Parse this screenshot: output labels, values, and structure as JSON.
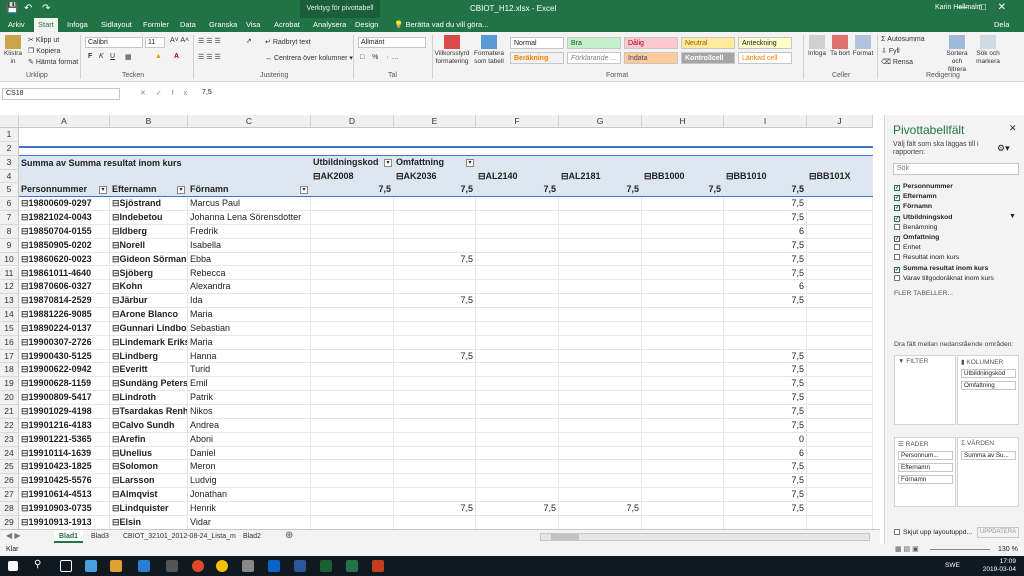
{
  "window": {
    "doc_title": "CBIOT_H12.xlsx - Excel",
    "context_tab": "Verktyg för pivottabell",
    "user": "Karin Hellmalm",
    "share": "Dela"
  },
  "tabs": [
    "Arkiv",
    "Start",
    "Infoga",
    "Sidlayout",
    "Formler",
    "Data",
    "Granska",
    "Visa",
    "Acrobat",
    "Analysera",
    "Design"
  ],
  "active_tab": "Start",
  "tell_me": "Berätta vad du vill göra...",
  "ribbon": {
    "clipboard": {
      "paste": "Klistra in",
      "cut": "Klipp ut",
      "copy": "Kopiera",
      "format_painter": "Hämta format",
      "label": "Urklipp"
    },
    "font": {
      "name": "Calibri",
      "size": "11",
      "label": "Tecken"
    },
    "alignment": {
      "wrap": "Radbryt text",
      "merge": "Centrera över kolumner",
      "label": "Justering"
    },
    "number": {
      "format": "Allmänt",
      "label": "Tal"
    },
    "styles": {
      "cond": "Villkorsstyrd formatering",
      "table": "Formatera som tabell",
      "cells": [
        "Normal",
        "Bra",
        "Dålig",
        "Neutral",
        "Anteckning",
        "Beräkning",
        "Förklarande ...",
        "Indata",
        "Kontrollcell",
        "Länkad cell"
      ],
      "label": "Format"
    },
    "cells_grp": {
      "insert": "Infoga",
      "delete": "Ta bort",
      "format": "Format",
      "label": "Celler"
    },
    "editing": {
      "autosum": "Autosumma",
      "fill": "Fyll",
      "clear": "Rensa",
      "sort": "Sortera och filtrera",
      "find": "Sök och markera",
      "label": "Redigering"
    }
  },
  "formula_bar": {
    "name_box": "CS18",
    "value": "7,5"
  },
  "columns": [
    "A",
    "B",
    "C",
    "D",
    "E",
    "F",
    "G",
    "H",
    "I",
    "J"
  ],
  "pivot": {
    "title": "Summa av Summa resultat inom kurs",
    "col_field1": "Utbildningskod",
    "col_field2": "Omfattning",
    "row_headers": [
      "Personnummer",
      "Efternamn",
      "Förnamn"
    ],
    "col_codes": [
      "AK2008",
      "AK2036",
      "AL2140",
      "AL2181",
      "BB1000",
      "BB1010",
      "BB101X"
    ],
    "col_totals": [
      "7,5",
      "7,5",
      "7,5",
      "7,5",
      "7,5",
      "7,5",
      ""
    ],
    "rows": [
      {
        "r": "6",
        "pn": "19800609-0297",
        "en": "Sjöstrand",
        "fn": "Marcus Paul",
        "v": [
          "",
          "",
          "",
          "",
          "",
          "7,5"
        ]
      },
      {
        "r": "7",
        "pn": "19821024-0043",
        "en": "Indebetou",
        "fn": "Johanna Lena Sörensdotter",
        "v": [
          "",
          "",
          "",
          "",
          "",
          "7,5"
        ]
      },
      {
        "r": "8",
        "pn": "19850704-0155",
        "en": "Idberg",
        "fn": "Fredrik",
        "v": [
          "",
          "",
          "",
          "",
          "",
          "6"
        ]
      },
      {
        "r": "9",
        "pn": "19850905-0202",
        "en": "Norell",
        "fn": "Isabella",
        "v": [
          "",
          "",
          "",
          "",
          "",
          "7,5"
        ]
      },
      {
        "r": "10",
        "pn": "19860620-0023",
        "en": "Gideon Sörman",
        "fn": "Ebba",
        "v": [
          "",
          "7,5",
          "",
          "",
          "",
          "7,5"
        ]
      },
      {
        "r": "11",
        "pn": "19861011-4640",
        "en": "Sjöberg",
        "fn": "Rebecca",
        "v": [
          "",
          "",
          "",
          "",
          "",
          "7,5"
        ]
      },
      {
        "r": "12",
        "pn": "19870606-0327",
        "en": "Kohn",
        "fn": "Alexandra",
        "v": [
          "",
          "",
          "",
          "",
          "",
          "6"
        ]
      },
      {
        "r": "13",
        "pn": "19870814-2529",
        "en": "Järbur",
        "fn": "Ida",
        "v": [
          "",
          "7,5",
          "",
          "",
          "",
          "7,5"
        ]
      },
      {
        "r": "14",
        "pn": "19881226-9085",
        "en": "Arone Blanco",
        "fn": "Maria",
        "v": [
          "",
          "",
          "",
          "",
          "",
          ""
        ]
      },
      {
        "r": "15",
        "pn": "19890224-0137",
        "en": "Gunnari Lindbor",
        "fn": "Sebastian",
        "v": [
          "",
          "",
          "",
          "",
          "",
          ""
        ]
      },
      {
        "r": "16",
        "pn": "19900307-2726",
        "en": "Lindemark Eriks",
        "fn": "Maria",
        "v": [
          "",
          "",
          "",
          "",
          "",
          ""
        ]
      },
      {
        "r": "17",
        "pn": "19900430-5125",
        "en": "Lindberg",
        "fn": "Hanna",
        "v": [
          "",
          "7,5",
          "",
          "",
          "",
          "7,5"
        ]
      },
      {
        "r": "18",
        "pn": "19900622-0942",
        "en": "Everitt",
        "fn": "Turid",
        "v": [
          "",
          "",
          "",
          "",
          "",
          "7,5"
        ]
      },
      {
        "r": "19",
        "pn": "19900628-1159",
        "en": "Sundäng Peters",
        "fn": "Emil",
        "v": [
          "",
          "",
          "",
          "",
          "",
          "7,5"
        ]
      },
      {
        "r": "20",
        "pn": "19900809-5417",
        "en": "Lindroth",
        "fn": "Patrik",
        "v": [
          "",
          "",
          "",
          "",
          "",
          "7,5"
        ]
      },
      {
        "r": "21",
        "pn": "19901029-4198",
        "en": "Tsardakas Renh",
        "fn": "Nikos",
        "v": [
          "",
          "",
          "",
          "",
          "",
          "7,5"
        ]
      },
      {
        "r": "22",
        "pn": "19901216-4183",
        "en": "Calvo Sundh",
        "fn": "Andrea",
        "v": [
          "",
          "",
          "",
          "",
          "",
          "7,5"
        ]
      },
      {
        "r": "23",
        "pn": "19901221-5365",
        "en": "Arefin",
        "fn": "Aboni",
        "v": [
          "",
          "",
          "",
          "",
          "",
          "0"
        ]
      },
      {
        "r": "24",
        "pn": "19910114-1639",
        "en": "Unelius",
        "fn": "Daniel",
        "v": [
          "",
          "",
          "",
          "",
          "",
          "6"
        ]
      },
      {
        "r": "25",
        "pn": "19910423-1825",
        "en": "Solomon",
        "fn": "Meron",
        "v": [
          "",
          "",
          "",
          "",
          "",
          "7,5"
        ]
      },
      {
        "r": "26",
        "pn": "19910425-5576",
        "en": "Larsson",
        "fn": "Ludvig",
        "v": [
          "",
          "",
          "",
          "",
          "",
          "7,5"
        ]
      },
      {
        "r": "27",
        "pn": "19910614-4513",
        "en": "Almqvist",
        "fn": "Jonathan",
        "v": [
          "",
          "",
          "",
          "",
          "",
          "7,5"
        ]
      },
      {
        "r": "28",
        "pn": "19910903-0735",
        "en": "Lindquister",
        "fn": "Henrik",
        "v": [
          "",
          "7,5",
          "7,5",
          "7,5",
          "",
          "7,5"
        ]
      },
      {
        "r": "29",
        "pn": "19910913-1913",
        "en": "Elsin",
        "fn": "Vidar",
        "v": [
          "",
          "",
          "",
          "",
          "",
          ""
        ]
      }
    ]
  },
  "panel": {
    "title": "Pivottabellfält",
    "subtitle": "Välj fält som ska läggas till i rapporten:",
    "search": "Sök",
    "fields": [
      {
        "name": "Personnummer",
        "checked": true
      },
      {
        "name": "Efternamn",
        "checked": true
      },
      {
        "name": "Förnamn",
        "checked": true
      },
      {
        "name": "Utbildningskod",
        "checked": true
      },
      {
        "name": "Benämning",
        "checked": false
      },
      {
        "name": "Omfattning",
        "checked": true
      },
      {
        "name": "Enhet",
        "checked": false
      },
      {
        "name": "Resultat inom kurs",
        "checked": false
      },
      {
        "name": "Summa resultat inom kurs",
        "checked": true
      },
      {
        "name": "Varav tillgodoräknat inom kurs",
        "checked": false
      }
    ],
    "more_tables": "FLER TABELLER...",
    "drag_label": "Dra fält mellan nedanstående områden:",
    "zones": {
      "filter": "FILTER",
      "columns": "KOLUMNER",
      "columns_items": [
        "Utbildningskod",
        "Omfattning"
      ],
      "rows": "RADER",
      "rows_items": [
        "Personnum...",
        "Efternamn",
        "Förnamn"
      ],
      "values": "VÄRDEN",
      "values_items": [
        "Summa av Su..."
      ]
    },
    "defer": "Skjut upp layoutuppd...",
    "update": "UPPDATERA"
  },
  "sheets": [
    "Blad1",
    "Blad3",
    "CBIOT_32101_2012-08-24_Lista_m",
    "Blad2"
  ],
  "active_sheet": "Blad1",
  "status": {
    "ready": "Klar",
    "zoom": "130 %"
  },
  "taskbar": {
    "time": "17:09",
    "date": "2019-03-04",
    "lang": "SWE"
  }
}
